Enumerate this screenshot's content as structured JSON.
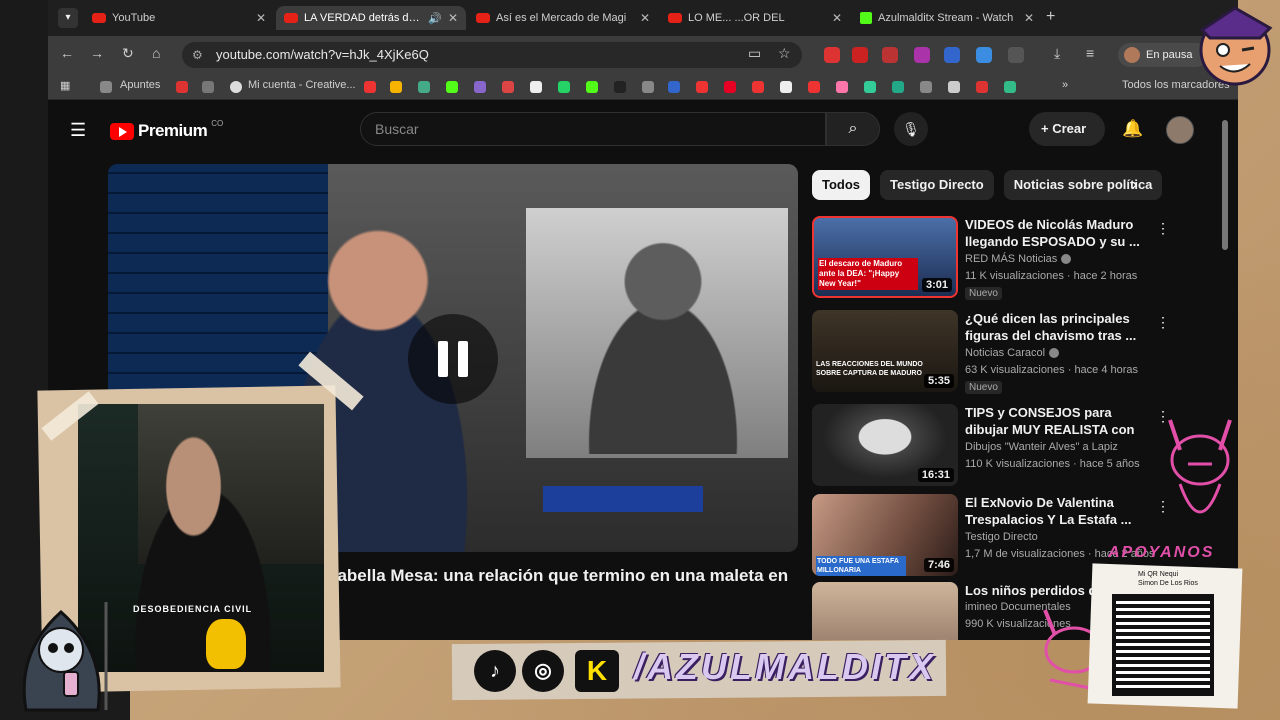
{
  "browser": {
    "tabs": [
      {
        "title": "YouTube",
        "icon": "youtube-icon",
        "active": false
      },
      {
        "title": "LA VERDAD detrás del c",
        "icon": "youtube-icon",
        "active": true
      },
      {
        "title": "Así es el Mercado de Magi",
        "icon": "youtube-icon",
        "active": false
      },
      {
        "title": "LO ME... ...OR DEL",
        "icon": "youtube-icon",
        "active": false
      },
      {
        "title": "Azulmalditx Stream - Watch",
        "icon": "kick-icon",
        "active": false
      }
    ],
    "url": "youtube.com/watch?v=hJk_4XjKe6Q",
    "profile_status": "En pausa",
    "bookmarks": [
      "Apuntes",
      "Mi cuenta - Creative...",
      "Todos los marcadores"
    ]
  },
  "youtube": {
    "logo_text": "Premium",
    "logo_region": "CO",
    "search_placeholder": "Buscar",
    "create_label": "Crear",
    "video_title": "sabella Mesa: una relación que termino en una maleta en",
    "chips": [
      "Todos",
      "Testigo Directo",
      "Noticias sobre política"
    ],
    "recommendations": [
      {
        "title": "VIDEOS de Nicolás Maduro llegando ESPOSADO y su ...",
        "channel": "RED MÁS Noticias",
        "meta": "11 K visualizaciones · hace 2 horas",
        "badge": "Nuevo",
        "duration": "3:01",
        "thumb_text": "El descaro de Maduro ante la DEA: \"¡Happy New Year!\""
      },
      {
        "title": "¿Qué dicen las principales figuras del chavismo tras ...",
        "channel": "Noticias Caracol",
        "meta": "63 K visualizaciones · hace 4 horas",
        "badge": "Nuevo",
        "duration": "5:35",
        "thumb_text": "LAS REACCIONES DEL MUNDO SOBRE CAPTURA DE MADURO"
      },
      {
        "title": "TIPS y CONSEJOS para dibujar MUY REALISTA con LAPICES ...",
        "channel": "Dibujos \"Wanteir Alves\" a Lapiz",
        "meta": "110 K visualizaciones · hace 5 años",
        "badge": "",
        "duration": "16:31",
        "thumb_text": ""
      },
      {
        "title": "El ExNovio De Valentina Trespalacios Y La Estafa ...",
        "channel": "Testigo Directo",
        "meta": "1,7 M de visualizaciones · hace 2 años",
        "badge": "",
        "duration": "7:46",
        "thumb_text": "TODO FUE UNA ESTAFA MILLONARIA"
      },
      {
        "title": "Los niños perdidos de ...",
        "channel": "imineo Documentales",
        "meta": "990 K visualizaciones",
        "badge": "",
        "duration": "",
        "thumb_text": ""
      }
    ]
  },
  "overlay": {
    "handle": "/AZULMALDITX",
    "apoyanos": "APOYANOS",
    "qr_label_1": "Mi QR Nequi",
    "qr_label_2": "Simon De Los Rios",
    "shirt_text": "DESOBEDIENCIA CIVIL",
    "kick_letter": "K"
  },
  "colors": {
    "youtube_red": "#ff0000",
    "background": "#0f0f0f",
    "kick_green": "#53fc18",
    "accent_pink": "#e14fa8"
  }
}
